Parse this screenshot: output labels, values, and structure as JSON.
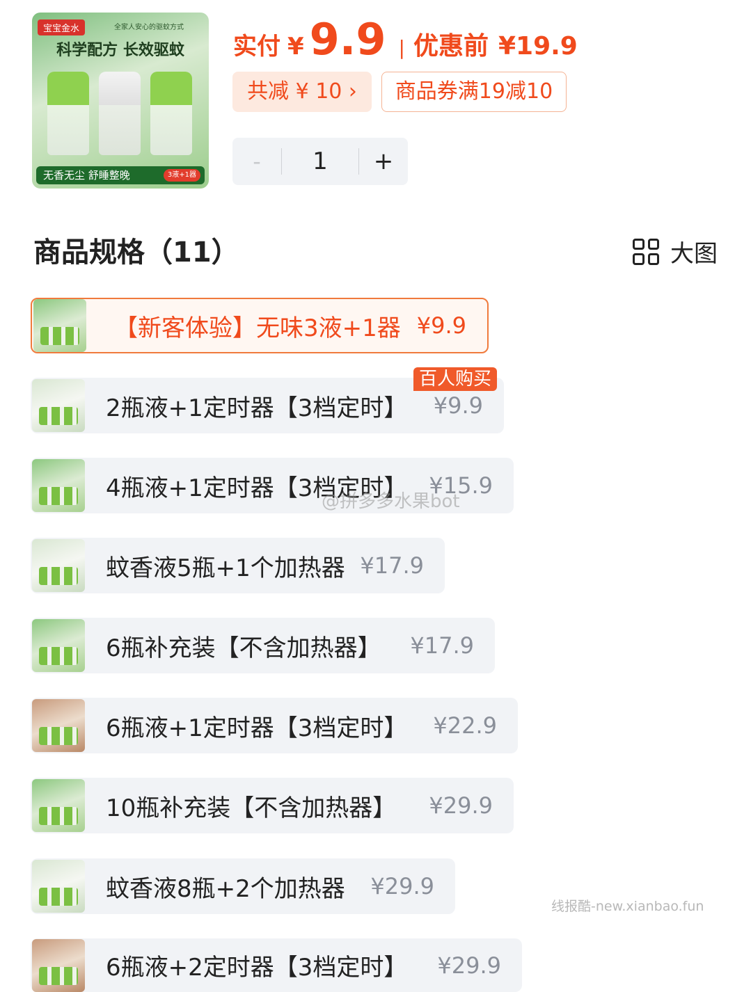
{
  "product": {
    "brand": "宝宝金水",
    "tagline": "全家人安心的驱蚊方式",
    "headline": "科学配方 长效驱蚊",
    "footer_text": "无香无尘 舒睡整晚",
    "footer_badge": "3液+1器"
  },
  "price": {
    "paid_label": "实付",
    "paid_currency": "¥",
    "paid_value": "9.9",
    "separator": "|",
    "before_label": "优惠前",
    "before_value": "¥19.9"
  },
  "discount": {
    "total_saving": "共减 ¥ 10 ›",
    "coupon": "商品券满19减10"
  },
  "quantity": {
    "minus": "-",
    "value": "1",
    "plus": "+"
  },
  "specs": {
    "title": "商品规格（11）",
    "big_view_label": "大图",
    "options": [
      {
        "name": "【新客体验】无味3液+1器",
        "price": "¥9.9",
        "selected": true
      },
      {
        "name": "2瓶液+1定时器【3档定时】",
        "price": "¥9.9",
        "badge": "百人购买"
      },
      {
        "name": "4瓶液+1定时器【3档定时】",
        "price": "¥15.9"
      },
      {
        "name": "蚊香液5瓶+1个加热器",
        "price": "¥17.9"
      },
      {
        "name": "6瓶补充装【不含加热器】",
        "price": "¥17.9"
      },
      {
        "name": "6瓶液+1定时器【3档定时】",
        "price": "¥22.9"
      },
      {
        "name": "10瓶补充装【不含加热器】",
        "price": "¥29.9"
      },
      {
        "name": "蚊香液8瓶+2个加热器",
        "price": "¥29.9"
      },
      {
        "name": "6瓶液+2定时器【3档定时】",
        "price": "¥29.9"
      }
    ]
  },
  "watermarks": {
    "weibo": "@拼多多水果bot",
    "site": "线报酷-new.xianbao.fun"
  },
  "colors": {
    "accent": "#f04a1c",
    "selected_border": "#f07a3c",
    "option_bg": "#f1f3f6"
  }
}
